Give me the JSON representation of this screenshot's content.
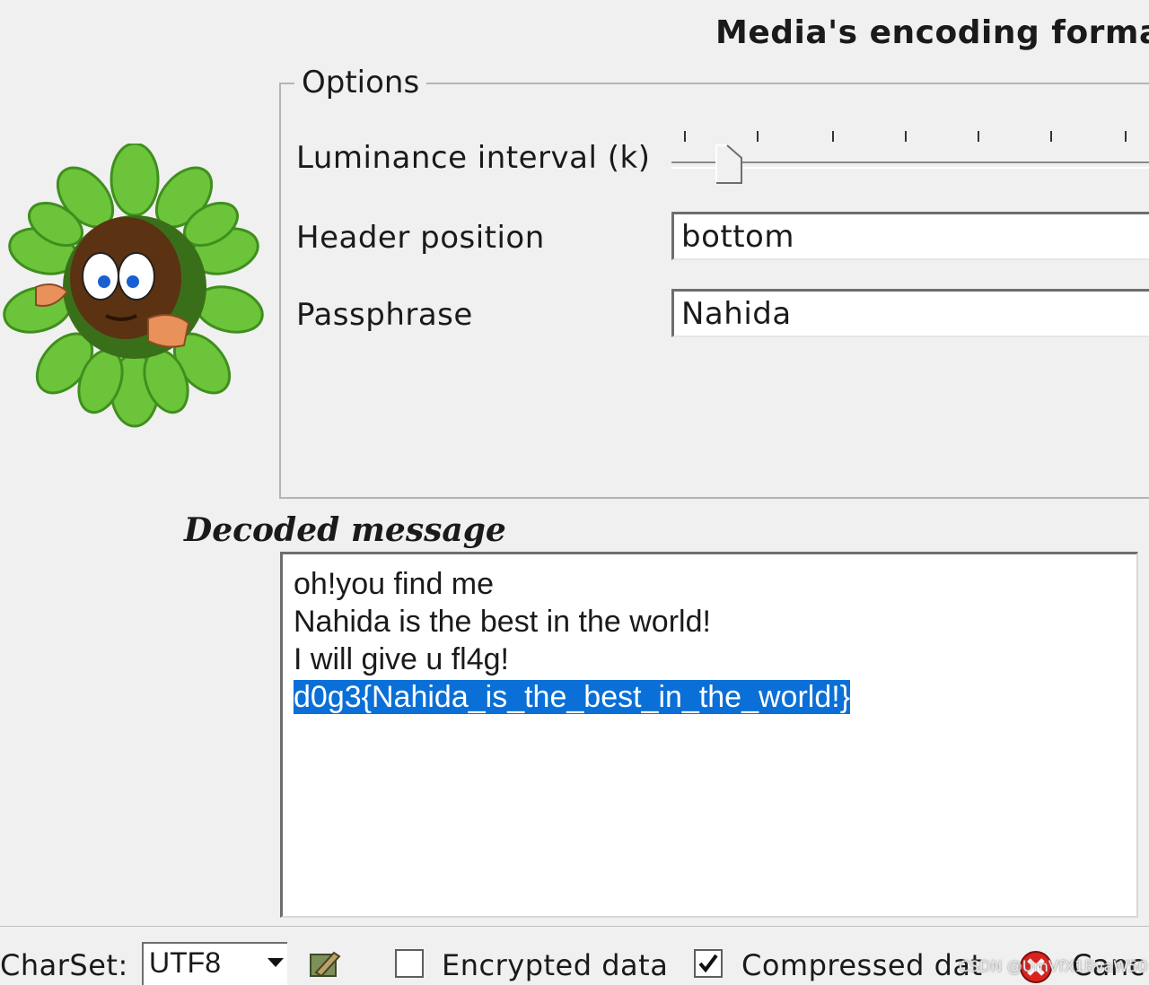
{
  "header": {
    "media_title": "Media's encoding format"
  },
  "options": {
    "legend": "Options",
    "luminance_label": "Luminance interval (k)",
    "luminance_level": 0,
    "header_position_label": "Header position",
    "header_position_value": "bottom",
    "passphrase_label": "Passphrase",
    "passphrase_value": "Nahida"
  },
  "decoded": {
    "title": "Decoded message",
    "lines": [
      "oh!you find me",
      "Nahida is the best in the world!",
      "I will give u fl4g!"
    ],
    "selected_line": "d0g3{Nahida_is_the_best_in_the_world!}"
  },
  "bottom": {
    "charset_label": "CharSet:",
    "charset_value": "UTF8",
    "encrypted_label": "Encrypted data",
    "encrypted_checked": false,
    "compressed_label": "Compressed dat",
    "compressed_checked": true,
    "cancel_label": "Canc"
  },
  "watermark": "CSDN @UmVfX1BvaW50"
}
